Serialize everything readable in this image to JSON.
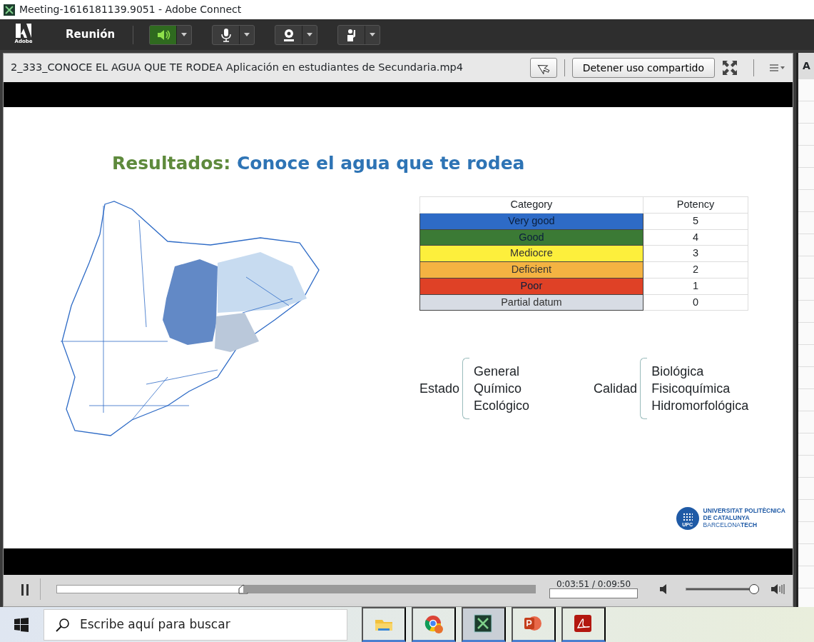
{
  "window": {
    "title": "Meeting-1616181139.9051 - Adobe Connect"
  },
  "toolbar": {
    "logo": "Adobe",
    "menu": "Reunión",
    "buttons": [
      {
        "kind": "speaker",
        "active": true
      },
      {
        "kind": "microphone",
        "active": false
      },
      {
        "kind": "camera",
        "active": false
      },
      {
        "kind": "raise-hand",
        "active": false
      }
    ]
  },
  "pod": {
    "title": "2_333_CONOCE EL AGUA QUE TE RODEA Aplicación en estudiantes de Secundaria.mp4",
    "stop_button": "Detener uso compartido"
  },
  "slide": {
    "heading": "Resultados:",
    "title": "Conoce el agua que te rodea",
    "table": {
      "columns": [
        "Category",
        "Potency"
      ],
      "rows": [
        {
          "category": "Very good",
          "potency": "5",
          "color": "#2e6bc6"
        },
        {
          "category": "Good",
          "potency": "4",
          "color": "#3b7a35"
        },
        {
          "category": "Mediocre",
          "potency": "3",
          "color": "#fdef3c"
        },
        {
          "category": "Deficient",
          "potency": "2",
          "color": "#f4b342"
        },
        {
          "category": "Poor",
          "potency": "1",
          "color": "#df4126"
        },
        {
          "category": "Partial datum",
          "potency": "0",
          "color": "#d7dce4"
        }
      ]
    },
    "groups": [
      {
        "label": "Estado",
        "items": [
          "General",
          "Químico",
          "Ecológico"
        ]
      },
      {
        "label": "Calidad",
        "items": [
          "Biológica",
          "Fisicoquímica",
          "Hidromorfológica"
        ]
      }
    ],
    "logo": {
      "mark": "UPC",
      "lines": [
        "UNIVERSITAT POLITÈCNICA",
        "DE CATALUNYA",
        "BARCELONA**TECH**"
      ]
    }
  },
  "player": {
    "playing": true,
    "progress": {
      "level": 0.39
    },
    "time": "0:03:51 / 0:09:50",
    "volume": {
      "level": 0.97
    }
  },
  "side_panel": {
    "header": "A"
  },
  "taskbar": {
    "search": {
      "placeholder": "Escribe aquí para buscar"
    },
    "apps": [
      {
        "kind": "folder",
        "selected": false
      },
      {
        "kind": "browser",
        "selected": false
      },
      {
        "kind": "connect",
        "selected": true
      },
      {
        "kind": "slides",
        "selected": false
      },
      {
        "kind": "pdf",
        "selected": false
      }
    ]
  }
}
